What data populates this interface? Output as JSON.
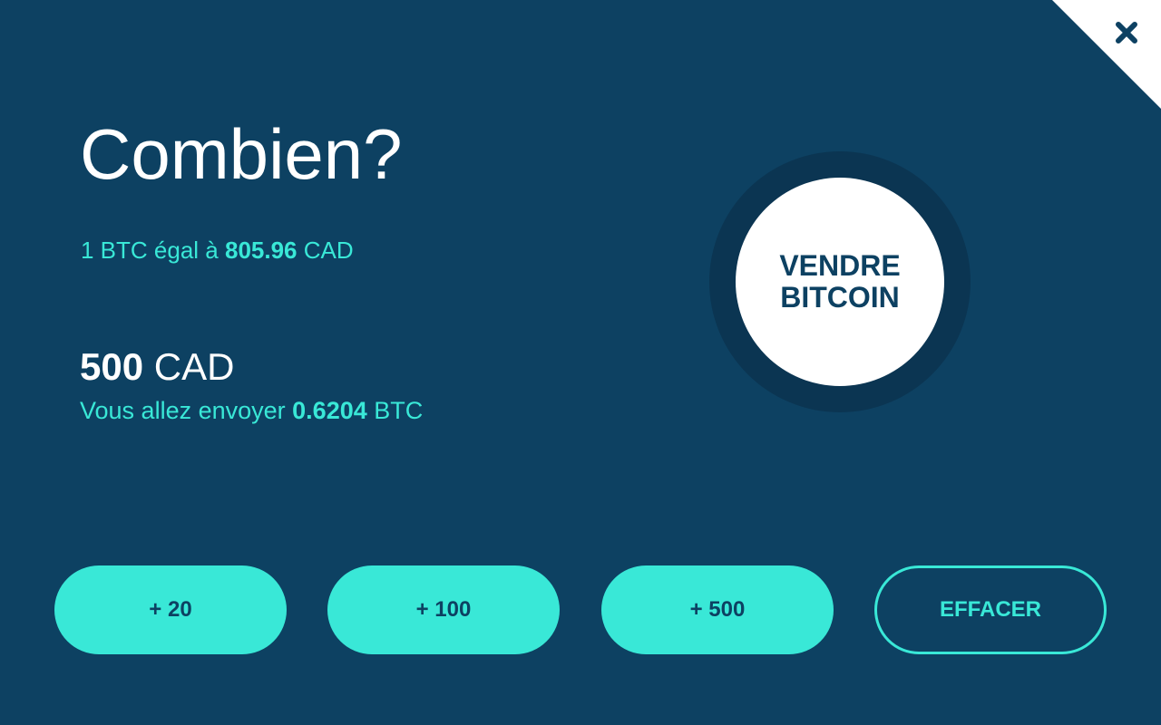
{
  "header": {
    "title": "Combien?",
    "close_icon": "close-icon"
  },
  "rate": {
    "prefix": "1 BTC égal à",
    "value": "805.96",
    "currency": "CAD"
  },
  "amount": {
    "value": "500",
    "currency": "CAD"
  },
  "send": {
    "prefix": "Vous allez envoyer",
    "value": "0.6204",
    "currency": "BTC"
  },
  "sell_button": {
    "line1": "VENDRE",
    "line2": "BITCOIN"
  },
  "quick_add": [
    {
      "label": "+ 20"
    },
    {
      "label": "+ 100"
    },
    {
      "label": "+ 500"
    }
  ],
  "clear_button": {
    "label": "EFFACER"
  },
  "colors": {
    "background": "#0d4162",
    "accent": "#39e8d7",
    "ring": "#0b3552",
    "white": "#ffffff"
  }
}
